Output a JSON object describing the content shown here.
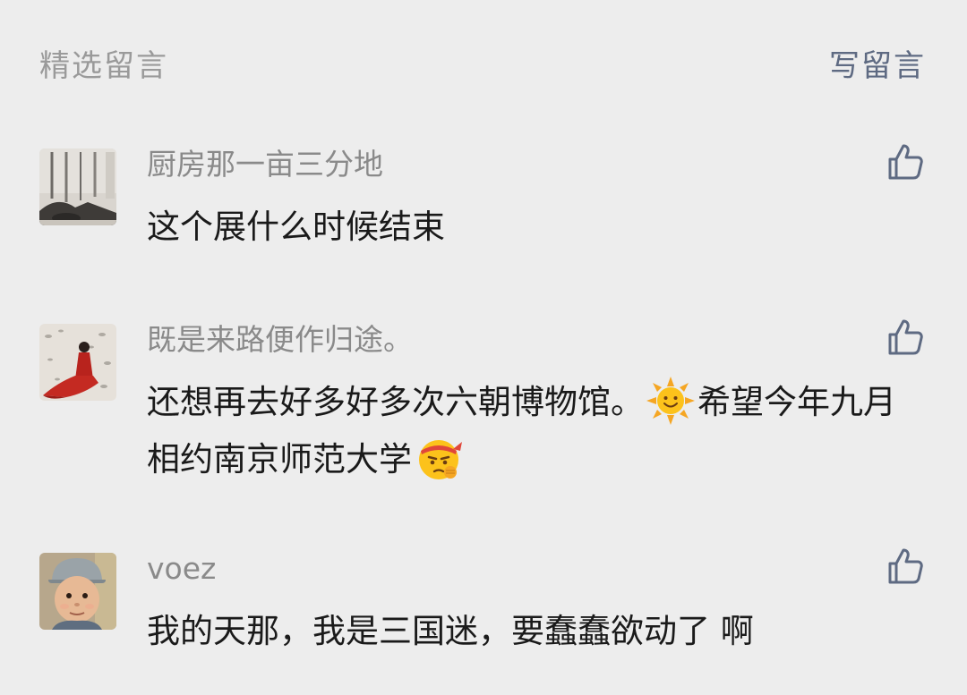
{
  "header": {
    "title": "精选留言",
    "write_label": "写留言"
  },
  "comments": [
    {
      "nickname": "厨房那一亩三分地",
      "text": "这个展什么时候结束",
      "avatar_icon": "kitchen-photo-avatar",
      "like_icon": "thumbs-up-icon"
    },
    {
      "nickname": "既是来路便作归途。",
      "text_part1": "还想再去好多好多次六朝博物馆。",
      "emoji1": "sun-emoji",
      "text_part2": "希望今年九月相约南京师范大学",
      "emoji2": "determined-face-emoji",
      "avatar_icon": "woman-red-dress-avatar",
      "like_icon": "thumbs-up-icon"
    },
    {
      "nickname": "voez",
      "text": "我的天那，我是三国迷，要蠢蠢欲动了 啊",
      "avatar_icon": "baby-photo-avatar",
      "like_icon": "thumbs-up-icon"
    }
  ],
  "colors": {
    "background": "#ededed",
    "link": "#5e6a82",
    "muted": "#9a9a9a",
    "text": "#1a1a1a"
  }
}
